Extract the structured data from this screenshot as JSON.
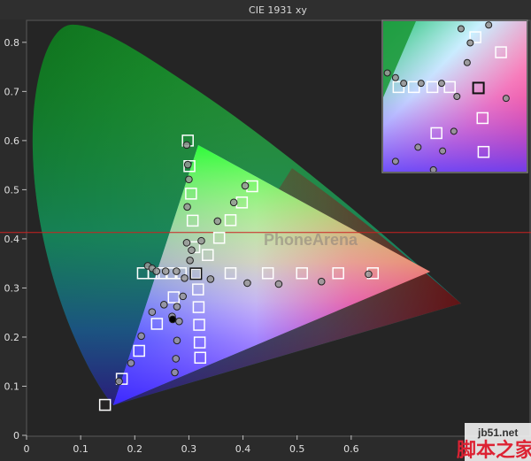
{
  "chart_data": {
    "type": "scatter",
    "title": "CIE 1931 xy",
    "xlim": [
      0,
      0.7
    ],
    "ylim": [
      0,
      0.85
    ],
    "x_ticks": [
      "0",
      "0.1",
      "0.2",
      "0.3",
      "0.4",
      "0.5",
      "0.6"
    ],
    "y_ticks": [
      "0",
      "0.1",
      "0.2",
      "0.3",
      "0.4",
      "0.5",
      "0.6",
      "0.7",
      "0.8"
    ],
    "grid": false,
    "legend": "none",
    "reference_line_y": 0.413,
    "reference_line_color": "#cc2222",
    "gamut_triangle": [
      [
        0.64,
        0.33
      ],
      [
        0.3,
        0.6
      ],
      [
        0.15,
        0.06
      ]
    ],
    "series": [
      {
        "marker": "square",
        "points": [
          [
            0.145,
            0.062
          ],
          [
            0.176,
            0.115
          ],
          [
            0.208,
            0.172
          ],
          [
            0.241,
            0.227
          ],
          [
            0.272,
            0.281
          ],
          [
            0.313,
            0.329
          ],
          [
            0.298,
            0.6
          ],
          [
            0.301,
            0.548
          ],
          [
            0.304,
            0.492
          ],
          [
            0.307,
            0.437
          ],
          [
            0.31,
            0.383
          ],
          [
            0.417,
            0.507
          ],
          [
            0.398,
            0.474
          ],
          [
            0.377,
            0.438
          ],
          [
            0.356,
            0.402
          ],
          [
            0.335,
            0.367
          ],
          [
            0.64,
            0.33
          ],
          [
            0.576,
            0.33
          ],
          [
            0.509,
            0.33
          ],
          [
            0.446,
            0.33
          ],
          [
            0.377,
            0.33
          ],
          [
            0.215,
            0.33
          ],
          [
            0.235,
            0.33
          ],
          [
            0.25,
            0.33
          ],
          [
            0.268,
            0.33
          ],
          [
            0.285,
            0.33
          ],
          [
            0.317,
            0.297
          ],
          [
            0.318,
            0.261
          ],
          [
            0.319,
            0.225
          ],
          [
            0.32,
            0.189
          ],
          [
            0.321,
            0.158
          ]
        ]
      },
      {
        "marker": "circle",
        "points": [
          [
            0.296,
            0.591
          ],
          [
            0.298,
            0.551
          ],
          [
            0.3,
            0.521
          ],
          [
            0.297,
            0.465
          ],
          [
            0.296,
            0.392
          ],
          [
            0.302,
            0.356
          ],
          [
            0.305,
            0.377
          ],
          [
            0.289,
            0.283
          ],
          [
            0.278,
            0.262
          ],
          [
            0.269,
            0.242
          ],
          [
            0.254,
            0.266
          ],
          [
            0.232,
            0.251
          ],
          [
            0.212,
            0.202
          ],
          [
            0.193,
            0.147
          ],
          [
            0.171,
            0.11
          ],
          [
            0.282,
            0.232
          ],
          [
            0.278,
            0.193
          ],
          [
            0.276,
            0.156
          ],
          [
            0.274,
            0.128
          ],
          [
            0.404,
            0.508
          ],
          [
            0.383,
            0.474
          ],
          [
            0.353,
            0.436
          ],
          [
            0.323,
            0.396
          ],
          [
            0.34,
            0.318
          ],
          [
            0.408,
            0.31
          ],
          [
            0.466,
            0.308
          ],
          [
            0.545,
            0.313
          ],
          [
            0.632,
            0.328
          ],
          [
            0.224,
            0.345
          ],
          [
            0.232,
            0.34
          ],
          [
            0.24,
            0.334
          ],
          [
            0.257,
            0.334
          ],
          [
            0.277,
            0.334
          ],
          [
            0.292,
            0.32
          ],
          [
            0.27,
            0.236
          ]
        ]
      }
    ]
  },
  "watermark": {
    "center_text": "PhoneArena",
    "site_url": "jb51.net",
    "site_name": "脚本之家"
  }
}
